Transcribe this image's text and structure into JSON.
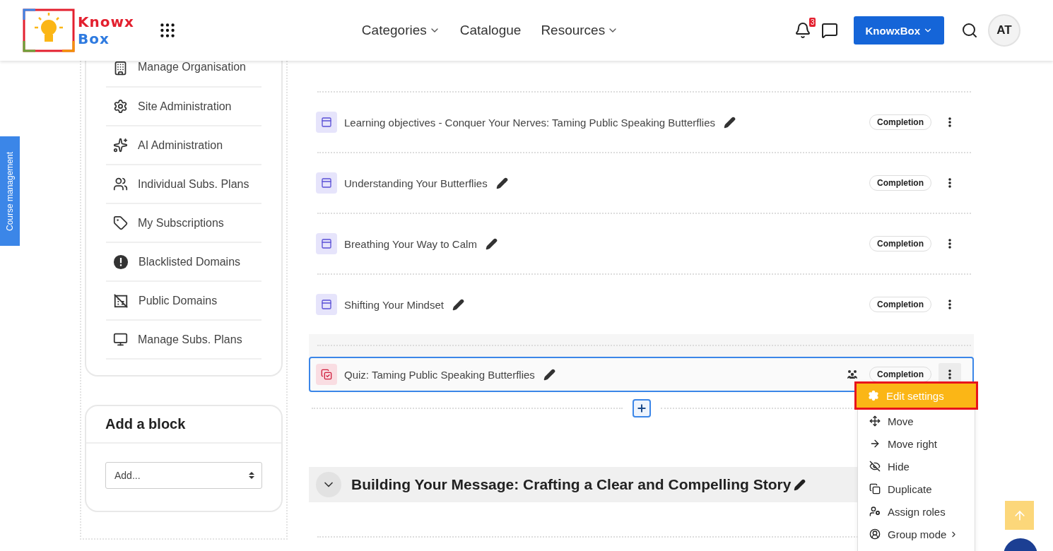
{
  "header": {
    "logo": {
      "line1": "Knowx",
      "line2": "Box"
    },
    "nav": [
      {
        "label": "Categories",
        "dropdown": true
      },
      {
        "label": "Catalogue",
        "dropdown": false
      },
      {
        "label": "Resources",
        "dropdown": true
      }
    ],
    "notification_count": "3",
    "org_button": "KnowxBox",
    "avatar": "AT"
  },
  "side_tab": "Course management",
  "sidebar_items": [
    {
      "label": "Manage Organisation"
    },
    {
      "label": "Site Administration"
    },
    {
      "label": "AI Administration"
    },
    {
      "label": "Individual Subs. Plans"
    },
    {
      "label": "My Subscriptions"
    },
    {
      "label": "Blacklisted Domains"
    },
    {
      "label": "Public Domains"
    },
    {
      "label": "Manage Subs. Plans"
    }
  ],
  "add_block": {
    "title": "Add a block",
    "select": {
      "value": "Add..."
    }
  },
  "activities": [
    {
      "kind": "page",
      "title": "Learning objectives - Conquer Your Nerves: Taming Public Speaking Butterflies",
      "badge": "Completion",
      "group_mode": false,
      "selected": false
    },
    {
      "kind": "page",
      "title": "Understanding Your Butterflies",
      "badge": "Completion",
      "group_mode": false,
      "selected": false
    },
    {
      "kind": "page",
      "title": "Breathing Your Way to Calm",
      "badge": "Completion",
      "group_mode": false,
      "selected": false
    },
    {
      "kind": "page",
      "title": "Shifting Your Mindset",
      "badge": "Completion",
      "group_mode": false,
      "selected": false
    },
    {
      "kind": "quiz",
      "title": "Quiz: Taming Public Speaking Butterflies",
      "badge": "Completion",
      "group_mode": true,
      "selected": true
    }
  ],
  "section": {
    "title": "Building Your Message: Crafting a Clear and Compelling Story",
    "expanded": true
  },
  "action_menu": [
    {
      "label": "Edit settings",
      "selected": true,
      "submenu": false
    },
    {
      "label": "Move",
      "selected": false,
      "submenu": false
    },
    {
      "label": "Move right",
      "selected": false,
      "submenu": false
    },
    {
      "label": "Hide",
      "selected": false,
      "submenu": false
    },
    {
      "label": "Duplicate",
      "selected": false,
      "submenu": false
    },
    {
      "label": "Assign roles",
      "selected": false,
      "submenu": false
    },
    {
      "label": "Group mode",
      "selected": false,
      "submenu": true
    }
  ]
}
